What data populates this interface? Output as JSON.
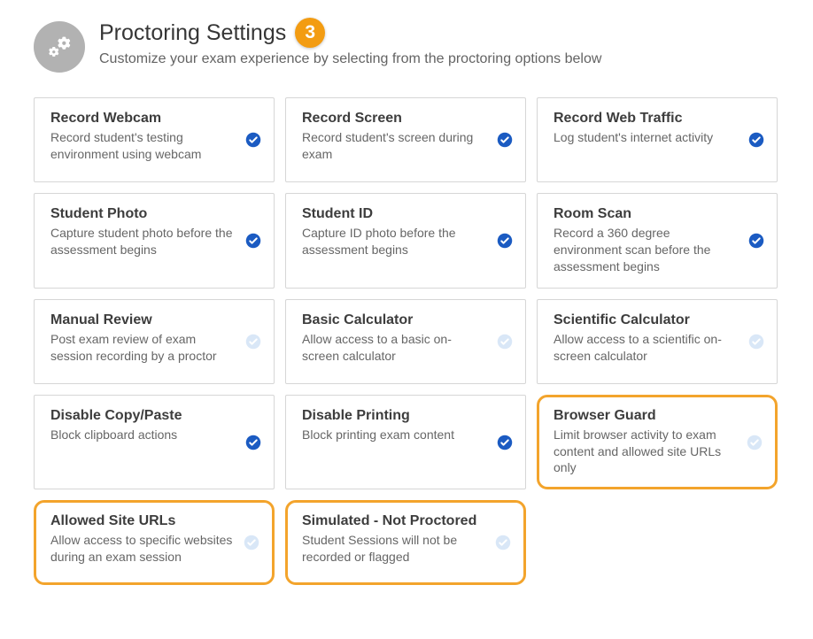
{
  "header": {
    "title": "Proctoring Settings",
    "step": "3",
    "subtitle": "Customize your exam experience by selecting from the proctoring options below"
  },
  "colors": {
    "checked": "#1b5bc2",
    "unchecked": "#d9e7f7"
  },
  "cards": [
    {
      "id": "record-webcam",
      "title": "Record Webcam",
      "desc": "Record student's testing environment using webcam",
      "checked": true,
      "highlight": false
    },
    {
      "id": "record-screen",
      "title": "Record Screen",
      "desc": "Record student's screen during exam",
      "checked": true,
      "highlight": false
    },
    {
      "id": "record-web-traffic",
      "title": "Record Web Traffic",
      "desc": "Log student's internet activity",
      "checked": true,
      "highlight": false
    },
    {
      "id": "student-photo",
      "title": "Student Photo",
      "desc": "Capture student photo before the assessment begins",
      "checked": true,
      "highlight": false
    },
    {
      "id": "student-id",
      "title": "Student ID",
      "desc": "Capture ID photo before the assessment begins",
      "checked": true,
      "highlight": false
    },
    {
      "id": "room-scan",
      "title": "Room Scan",
      "desc": "Record a 360 degree environment scan before the assessment begins",
      "checked": true,
      "highlight": false
    },
    {
      "id": "manual-review",
      "title": "Manual Review",
      "desc": "Post exam review of exam session recording by a proctor",
      "checked": false,
      "highlight": false
    },
    {
      "id": "basic-calculator",
      "title": "Basic Calculator",
      "desc": "Allow access to a basic on-screen calculator",
      "checked": false,
      "highlight": false
    },
    {
      "id": "scientific-calculator",
      "title": "Scientific Calculator",
      "desc": "Allow access to a scientific on-screen calculator",
      "checked": false,
      "highlight": false
    },
    {
      "id": "disable-copy-paste",
      "title": "Disable Copy/Paste",
      "desc": "Block clipboard actions",
      "checked": true,
      "highlight": false
    },
    {
      "id": "disable-printing",
      "title": "Disable Printing",
      "desc": "Block printing exam content",
      "checked": true,
      "highlight": false
    },
    {
      "id": "browser-guard",
      "title": "Browser Guard",
      "desc": "Limit browser activity to exam content and allowed site URLs only",
      "checked": false,
      "highlight": true
    },
    {
      "id": "allowed-site-urls",
      "title": "Allowed Site URLs",
      "desc": "Allow access to specific websites during an exam session",
      "checked": false,
      "highlight": true
    },
    {
      "id": "simulated-not-proctored",
      "title": "Simulated - Not Proctored",
      "desc": "Student Sessions will not be recorded or flagged",
      "checked": false,
      "highlight": true
    }
  ]
}
